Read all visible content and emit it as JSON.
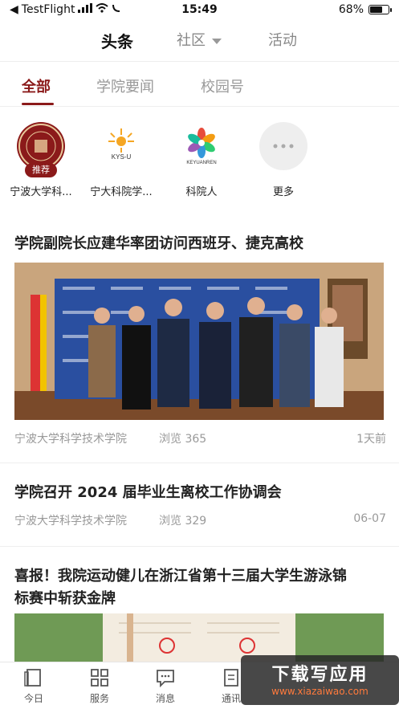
{
  "status_bar": {
    "carrier": "TestFlight",
    "time": "15:49",
    "battery": "68%",
    "battery_level": 0.68
  },
  "top_tabs": [
    {
      "label": "头条"
    },
    {
      "label": "社区"
    },
    {
      "label": "活动"
    }
  ],
  "sub_tabs": [
    {
      "label": "全部"
    },
    {
      "label": "学院要闻"
    },
    {
      "label": "校园号"
    }
  ],
  "channels": [
    {
      "label": "宁波大学科...",
      "badge": "推荐",
      "logo": "university-seal-logo",
      "color": "#8b1a1a"
    },
    {
      "label": "宁大科院学...",
      "logo": "kys-u-sun-logo",
      "logo_text": "KYS-U",
      "color": "#f5a623"
    },
    {
      "label": "科院人",
      "logo": "keyuanren-flower-logo",
      "logo_text": "KEYUANREN",
      "color": "#3a7bd5"
    },
    {
      "label": "更多",
      "logo": "more-icon",
      "color": "#eeeeee"
    }
  ],
  "articles": [
    {
      "title": "学院副院长应建华率团访问西班牙、捷克高校",
      "source": "宁波大学科学技术学院",
      "views": "浏览 365",
      "time": "1天前"
    },
    {
      "title": "学院召开 2024 届毕业生离校工作协调会",
      "source": "宁波大学科学技术学院",
      "views": "浏览 329",
      "time": "06-07"
    },
    {
      "title_line1": "喜报！我院运动健儿在浙江省第十三届大学生游泳锦",
      "title_line2": "标赛中斩获金牌"
    }
  ],
  "bottom_nav": [
    {
      "label": "今日"
    },
    {
      "label": "服务"
    },
    {
      "label": "消息"
    },
    {
      "label": "通讯"
    }
  ],
  "watermark": {
    "title": "下载写应用",
    "url": "www.xiazaiwao.com"
  }
}
